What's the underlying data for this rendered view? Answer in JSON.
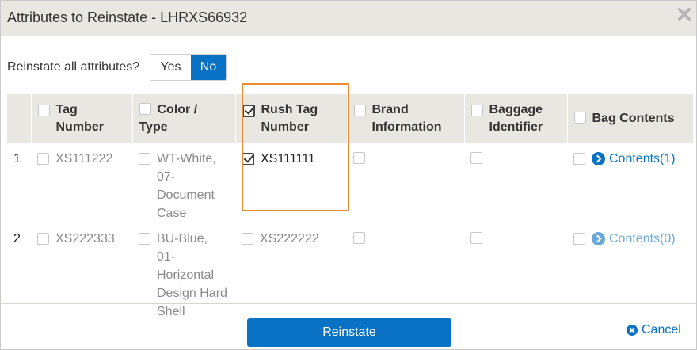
{
  "dialog": {
    "title": "Attributes to Reinstate - LHRXS66932"
  },
  "reinstate_all": {
    "label": "Reinstate all attributes?",
    "yes": "Yes",
    "no": "No",
    "selected": "No"
  },
  "columns": {
    "index": "",
    "tag_number": "Tag Number",
    "color_type": "Color / Type",
    "rush_tag_number": "Rush Tag Number",
    "brand_information": "Brand Information",
    "baggage_identifier": "Baggage Identifier",
    "bag_contents": "Bag Contents"
  },
  "rows": [
    {
      "index": "1",
      "tag_number": "XS111222",
      "color_type": "WT-White, 07-Document Case",
      "rush_tag_number": "XS111111",
      "contents": "Contents(1)"
    },
    {
      "index": "2",
      "tag_number": "XS222333",
      "color_type": "BU-Blue, 01-Horizontal Design Hard Shell",
      "rush_tag_number": "XS222222",
      "contents": "Contents(0)"
    }
  ],
  "footer": {
    "reinstate_label": "Reinstate",
    "cancel_label": "Cancel"
  },
  "colors": {
    "primary": "#0a72c5",
    "highlight": "#e98a35",
    "header_bg": "#e8e7e2"
  },
  "icons": {
    "close": "close-icon",
    "contents": "chevron-right-circle-icon",
    "cancel": "times-circle-icon"
  }
}
